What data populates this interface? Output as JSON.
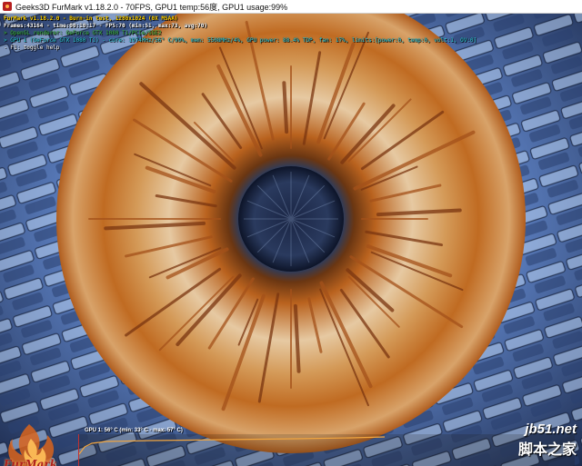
{
  "window": {
    "title": "Geeks3D FurMark v1.18.2.0 - 70FPS, GPU1 temp:56度, GPU1 usage:99%",
    "icon": "furmark-app-icon"
  },
  "hud": {
    "title": "FurMark v1.18.2.0 - Burn-in test, 1280x1024 (0X MSAA)",
    "frames": "Frames:43164 - time:00:10:17 - FPS:70 (min:51, max:73, avg:70)",
    "renderer": "> OpenGL renderer: GeForce GTX 1080 Ti/PCIe/SSE2",
    "gpu": "> GPU 1 (GeForce GTX 1080 Ti) - core: 1974MHz/56° C/99%, mem: 5508MHz/4%, GPU power: 88.4% TDP, fan: 17%, limits:[power:0, temp:0, volt:1, OV:0]",
    "help": "- F1: toggle help"
  },
  "graph": {
    "label": "GPU 1: 56° C (min: 33° C - max: 57° C)",
    "temp_line_color": "#f2a640",
    "axis_color": "#3ac9d6"
  },
  "logo": {
    "text": "FurMark"
  },
  "watermark": {
    "url": "jb51.net",
    "site": "脚本之家"
  },
  "colors": {
    "hud_title": "#ffd200",
    "hud_renderer": "#42c24a",
    "hud_gpu": "#2fd3e3",
    "iris_outer": "#c46a1a",
    "iris_inner": "#e8c9a0",
    "pupil": "#1e2a44",
    "background": "#5b7fc0"
  }
}
